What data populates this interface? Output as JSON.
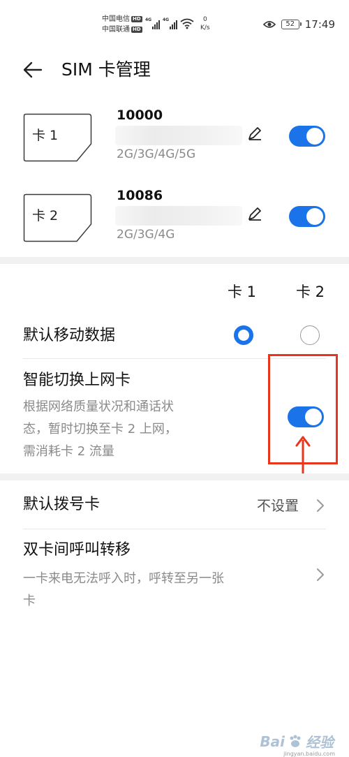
{
  "status_bar": {
    "carrier_1": "中国电信",
    "carrier_2": "中国联通",
    "hd_badge": "HD",
    "net_type": "4G",
    "speed_value": "0",
    "speed_unit": "K/s",
    "battery": "52",
    "time": "17:49"
  },
  "header": {
    "title": "SIM 卡管理"
  },
  "sims": [
    {
      "card_label": "卡 1",
      "number": "10000",
      "tech": "2G/3G/4G/5G",
      "enabled": true
    },
    {
      "card_label": "卡 2",
      "number": "10086",
      "tech": "2G/3G/4G",
      "enabled": true
    }
  ],
  "columns": {
    "card1": "卡 1",
    "card2": "卡 2"
  },
  "default_data": {
    "label": "默认移动数据",
    "selected": "card1"
  },
  "smart_switch": {
    "title": "智能切换上网卡",
    "desc_line1": "根据网络质量状况和通话状",
    "desc_line2": "态，暂时切换至卡 2 上网，",
    "desc_line3": "需消耗卡 2 流量",
    "enabled": true
  },
  "default_dial": {
    "label": "默认拨号卡",
    "value": "不设置"
  },
  "call_forward": {
    "title": "双卡间呼叫转移",
    "desc_line1": "一卡来电无法呼入时，呼转至另一张",
    "desc_line2": "卡"
  },
  "watermark": {
    "brand": "Bai",
    "brand2": "经验",
    "url": "jingyan.baidu.com"
  },
  "colors": {
    "accent": "#1a73e8",
    "highlight": "#e8351c"
  }
}
